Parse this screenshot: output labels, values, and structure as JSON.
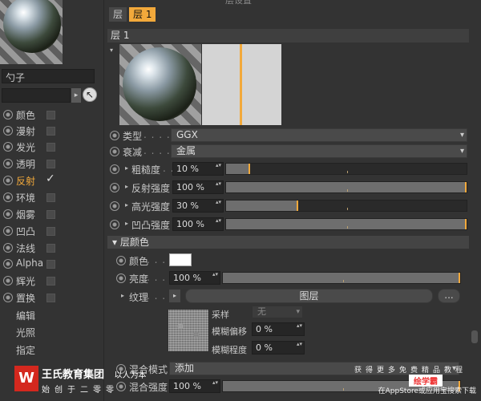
{
  "left": {
    "material_name": "勺子",
    "channels": [
      {
        "label": "颜色",
        "checked": false,
        "active": false
      },
      {
        "label": "漫射",
        "checked": false,
        "active": false
      },
      {
        "label": "发光",
        "checked": false,
        "active": false
      },
      {
        "label": "透明",
        "checked": false,
        "active": false
      },
      {
        "label": "反射",
        "checked": true,
        "active": true
      },
      {
        "label": "环境",
        "checked": false,
        "active": false
      },
      {
        "label": "烟雾",
        "checked": false,
        "active": false
      },
      {
        "label": "凹凸",
        "checked": false,
        "active": false
      },
      {
        "label": "法线",
        "checked": false,
        "active": false
      },
      {
        "label": "Alpha",
        "checked": false,
        "active": false
      },
      {
        "label": "辉光",
        "checked": false,
        "active": false
      },
      {
        "label": "置换",
        "checked": false,
        "active": false
      }
    ],
    "extras": [
      "编辑",
      "光照",
      "指定"
    ],
    "checkmark": "✓",
    "arrow": "▸",
    "picker_icon": "↖"
  },
  "right": {
    "top_partial": "层设置",
    "tabs": [
      "层",
      "层 1"
    ],
    "layer_header": "层 1",
    "collapse": "▾",
    "type": {
      "label": "类型",
      "dots": ". . . . .",
      "value": "GGX"
    },
    "attenuation": {
      "label": "衰减",
      "dots": ". . . . .",
      "value": "金属"
    },
    "roughness": {
      "label": "粗糙度",
      "dots": ". .",
      "value": "10 %",
      "level": 0.1
    },
    "reflect_strength": {
      "label": "反射强度",
      "value": "100 %",
      "level": 1.0
    },
    "specular_strength": {
      "label": "高光强度",
      "value": "30 %",
      "level": 0.3
    },
    "bump_strength": {
      "label": "凹凸强度",
      "value": "100 %",
      "level": 1.0
    },
    "section_title": "▾ 层颜色",
    "color": {
      "label": "颜色",
      "dots": ". . . . .",
      "swatch": "#ffffff"
    },
    "brightness": {
      "label": "亮度",
      "dots": ". . . . .",
      "value": "100 %",
      "level": 1.0
    },
    "texture": {
      "label": "纹理",
      "dots": ". . . . .",
      "value": "图层",
      "more": "..."
    },
    "sample": {
      "label": "采样",
      "value": "无"
    },
    "blur_offset": {
      "label": "模糊偏移",
      "value": "0 %"
    },
    "blur_degree": {
      "label": "模糊程度",
      "value": "0 %"
    },
    "blend_mode": {
      "label": "混合模式",
      "value": "添加"
    },
    "blend_strength": {
      "label": "混合强度",
      "value": "100 %",
      "level": 1.0
    },
    "arrow_down": "▾",
    "arrow_right": "▸",
    "spinner": "▴▾"
  },
  "watermark": {
    "logo": "W",
    "name": "王氏教育集团",
    "suffix": "以人为本",
    "slogan": "始创于二零零",
    "right_1": "获得更多免费精品教程",
    "right_2": "绘学霸",
    "right_3": "在AppStore或应用宝搜索下载"
  },
  "colors": {
    "accent": "#f2a93b",
    "panel": "#333333",
    "field": "#262626"
  }
}
